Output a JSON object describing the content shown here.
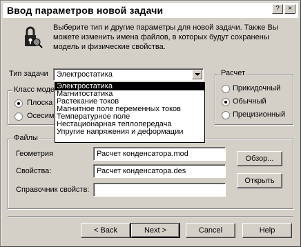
{
  "window": {
    "title": "Ввод параметров новой задачи"
  },
  "intro_text": "Выберите тип и другие параметры для новой задачи. Также Вы можете изменить имена файлов, в которых будут сохранены модель и физические свойства.",
  "task_type": {
    "label": "Тип задачи",
    "selected": "Электростатика",
    "options": [
      "Электростатика",
      "Магнитостатика",
      "Растекание токов",
      "Магнитное поле переменных токов",
      "Температурное поле",
      "Нестационарная теплопередача",
      "Упругие напряжения и деформации"
    ]
  },
  "model_class": {
    "label": "Класс моде",
    "options": [
      {
        "label": "Плоска",
        "checked": true
      },
      {
        "label": "Осесим",
        "checked": false
      }
    ]
  },
  "calculation": {
    "label": "Расчет",
    "options": [
      {
        "label": "Прикидочный",
        "checked": false
      },
      {
        "label": "Обычный",
        "checked": true
      },
      {
        "label": "Прецизионный",
        "checked": false
      }
    ]
  },
  "files": {
    "label": "Файлы",
    "geometry_label": "Геометрия",
    "geometry_value": "Расчет конденсатора.mod",
    "properties_label": "Свойства:",
    "properties_value": "Расчет конденсатора.des",
    "reference_label": "Справочник свойств:",
    "reference_value": "",
    "browse_button": "Обзор...",
    "open_button": "Открыть"
  },
  "buttons": {
    "back": "< Back",
    "next": "Next >",
    "cancel": "Cancel",
    "help": "Help"
  }
}
